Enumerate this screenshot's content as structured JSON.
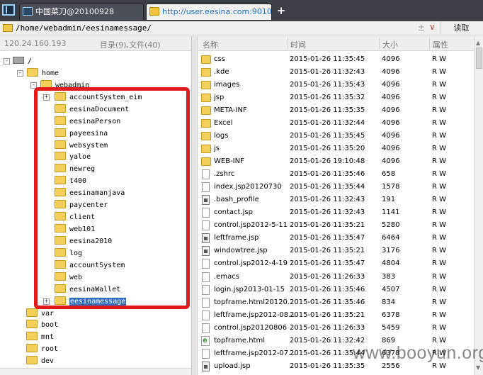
{
  "tabs": [
    {
      "label": "中国菜刀@20100928",
      "active": false
    },
    {
      "label": "http://user.eesina.com:9010/...",
      "active": true
    }
  ],
  "newtab_label": "+",
  "address": {
    "path": "/home/webadmin/eesinamessage/",
    "plus_minus": "±",
    "chevron": "∨",
    "read_button": "读取"
  },
  "left_head": {
    "ip": "120.24.160.193",
    "count": "目录(9),文件(40)"
  },
  "tree": [
    {
      "label": "/",
      "icon": "drive"
    },
    {
      "label": "home",
      "icon": "folder"
    },
    {
      "label": "webadmin",
      "icon": "folder"
    },
    {
      "label": "accountSystem_eim",
      "icon": "folder"
    },
    {
      "label": "eesinaDocument",
      "icon": "folder"
    },
    {
      "label": "eesinaPerson",
      "icon": "folder"
    },
    {
      "label": "payeesina",
      "icon": "folder"
    },
    {
      "label": "websystem",
      "icon": "folder"
    },
    {
      "label": "yaloe",
      "icon": "folder"
    },
    {
      "label": "newreg",
      "icon": "folder"
    },
    {
      "label": "t400",
      "icon": "folder"
    },
    {
      "label": "eesinamanjava",
      "icon": "folder"
    },
    {
      "label": "paycenter",
      "icon": "folder"
    },
    {
      "label": "client",
      "icon": "folder"
    },
    {
      "label": "web101",
      "icon": "folder"
    },
    {
      "label": "eesina2010",
      "icon": "folder"
    },
    {
      "label": "log",
      "icon": "folder"
    },
    {
      "label": "accountSystem",
      "icon": "folder"
    },
    {
      "label": "web",
      "icon": "folder"
    },
    {
      "label": "eesinaWallet",
      "icon": "folder"
    },
    {
      "label": "eesinamessage",
      "icon": "folder",
      "selected": true
    },
    {
      "label": "var",
      "icon": "folder"
    },
    {
      "label": "boot",
      "icon": "folder"
    },
    {
      "label": "mnt",
      "icon": "folder"
    },
    {
      "label": "root",
      "icon": "folder"
    },
    {
      "label": "dev",
      "icon": "folder"
    }
  ],
  "columns": {
    "name": "名称",
    "time": "时间",
    "size": "大小",
    "attr": "属性"
  },
  "files": [
    {
      "name": "css",
      "time": "2015-01-26 11:35:45",
      "size": "4096",
      "attr": "R W",
      "icon": "folder"
    },
    {
      "name": ".kde",
      "time": "2015-01-26 11:32:43",
      "size": "4096",
      "attr": "R W",
      "icon": "folder"
    },
    {
      "name": "images",
      "time": "2015-01-26 11:35:43",
      "size": "4096",
      "attr": "R W",
      "icon": "folder"
    },
    {
      "name": "jsp",
      "time": "2015-01-26 11:35:32",
      "size": "4096",
      "attr": "R W",
      "icon": "folder"
    },
    {
      "name": "META-INF",
      "time": "2015-01-26 11:35:35",
      "size": "4096",
      "attr": "R W",
      "icon": "folder"
    },
    {
      "name": "Excel",
      "time": "2015-01-26 11:32:44",
      "size": "4096",
      "attr": "R W",
      "icon": "folder"
    },
    {
      "name": "logs",
      "time": "2015-01-26 11:35:45",
      "size": "4096",
      "attr": "R W",
      "icon": "folder"
    },
    {
      "name": "js",
      "time": "2015-01-26 11:35:20",
      "size": "4096",
      "attr": "R W",
      "icon": "folder"
    },
    {
      "name": "WEB-INF",
      "time": "2015-01-26 19:10:48",
      "size": "4096",
      "attr": "R W",
      "icon": "folder"
    },
    {
      "name": ".zshrc",
      "time": "2015-01-26 11:35:46",
      "size": "658",
      "attr": "R W",
      "icon": "file"
    },
    {
      "name": "index.jsp20120730",
      "time": "2015-01-26 11:35:44",
      "size": "1578",
      "attr": "R W",
      "icon": "file"
    },
    {
      "name": ".bash_profile",
      "time": "2015-01-26 11:32:43",
      "size": "191",
      "attr": "R W",
      "icon": "bin"
    },
    {
      "name": "contact.jsp",
      "time": "2015-01-26 11:32:43",
      "size": "1141",
      "attr": "R W",
      "icon": "file"
    },
    {
      "name": "control.jsp2012-5-11",
      "time": "2015-01-26 11:35:21",
      "size": "5280",
      "attr": "R W",
      "icon": "file"
    },
    {
      "name": "leftframe.jsp",
      "time": "2015-01-26 11:35:47",
      "size": "6464",
      "attr": "R W",
      "icon": "bin"
    },
    {
      "name": "windowtree.jsp",
      "time": "2015-01-26 11:35:21",
      "size": "3176",
      "attr": "R W",
      "icon": "bin"
    },
    {
      "name": "control.jsp2012-4-19",
      "time": "2015-01-26 11:35:47",
      "size": "4804",
      "attr": "R W",
      "icon": "file"
    },
    {
      "name": ".emacs",
      "time": "2015-01-26 11:26:33",
      "size": "383",
      "attr": "R W",
      "icon": "file"
    },
    {
      "name": "login.jsp2013-01-15",
      "time": "2015-01-26 11:35:46",
      "size": "4507",
      "attr": "R W",
      "icon": "file"
    },
    {
      "name": "topframe.html20120...",
      "time": "2015-01-26 11:35:46",
      "size": "834",
      "attr": "R W",
      "icon": "file"
    },
    {
      "name": "leftframe.jsp2012-08...",
      "time": "2015-01-26 11:35:21",
      "size": "6378",
      "attr": "R W",
      "icon": "file"
    },
    {
      "name": "control.jsp20120806",
      "time": "2015-01-26 11:26:33",
      "size": "5459",
      "attr": "R W",
      "icon": "file"
    },
    {
      "name": "topframe.html",
      "time": "2015-01-26 11:32:42",
      "size": "869",
      "attr": "R W",
      "icon": "html"
    },
    {
      "name": "leftframe.jsp2012-07...",
      "time": "2015-01-26 11:35:44",
      "size": "6378",
      "attr": "R W",
      "icon": "file"
    },
    {
      "name": "upload.jsp",
      "time": "2015-01-26 11:35:35",
      "size": "2556",
      "attr": "R W",
      "icon": "bin"
    }
  ],
  "watermark": "www.booyun.org"
}
